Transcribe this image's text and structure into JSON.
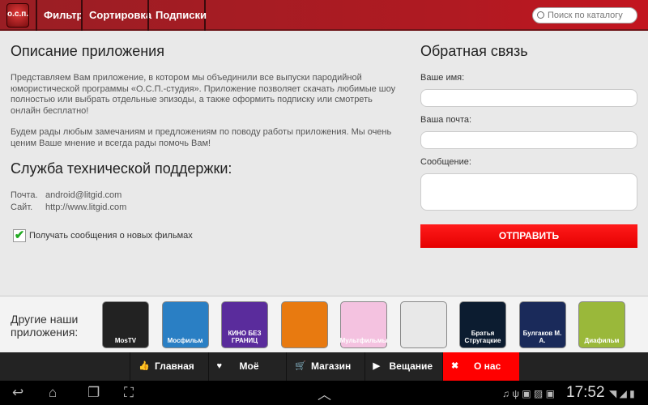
{
  "header": {
    "logo": "о.с.п.",
    "tabs": [
      "Фильтр",
      "Сортировка",
      "Подписки"
    ],
    "search_placeholder": "Поиск по каталогу"
  },
  "about": {
    "title": "Описание приложения",
    "p1": "Представляем Вам приложение, в котором мы объединили все выпуски пародийной юмористической программы «О.С.П.-студия». Приложение позволяет скачать любимые шоу полностью или выбрать отдельные эпизоды, а также оформить подписку или смотреть онлайн бесплатно!",
    "p2": "Будем рады любым замечаниям и предложениям по поводу работы приложения. Мы очень ценим Ваше мнение и всегда рады помочь Вам!"
  },
  "support": {
    "title": "Служба технической поддержки:",
    "mail_label": "Почта.",
    "mail": "android@litgid.com",
    "site_label": "Сайт.",
    "site": "http://www.litgid.com",
    "checkbox_label": "Получать сообщения о новых фильмах",
    "checkbox_checked": true
  },
  "feedback": {
    "title": "Обратная связь",
    "name_label": "Ваше имя:",
    "email_label": "Ваша почта:",
    "message_label": "Сообщение:",
    "name_value": "",
    "email_value": "",
    "message_value": "",
    "send": "ОТПРАВИТЬ"
  },
  "apps": {
    "label": "Другие наши приложения:",
    "items": [
      {
        "name": "MosTV",
        "color": "#222"
      },
      {
        "name": "Мосфильм",
        "color": "#2a7fc4"
      },
      {
        "name": "КИНО БЕЗ ГРАНИЦ",
        "color": "#5a2c9c"
      },
      {
        "name": "",
        "color": "#e87a10"
      },
      {
        "name": "Мультфильмы",
        "color": "#f4c2e0"
      },
      {
        "name": "",
        "color": "#e8e8e8"
      },
      {
        "name": "Братья Стругацкие",
        "color": "#0c1c30"
      },
      {
        "name": "Булгаков М. А.",
        "color": "#1a2a5a"
      },
      {
        "name": "Диафильм",
        "color": "#9ab83a"
      }
    ]
  },
  "nav": {
    "items": [
      {
        "icon": "👍",
        "label": "Главная"
      },
      {
        "icon": "♥",
        "label": "Моё"
      },
      {
        "icon": "🛒",
        "label": "Магазин"
      },
      {
        "icon": "▶",
        "label": "Вещание"
      },
      {
        "icon": "✖",
        "label": "О нас"
      }
    ],
    "active_color": "#ff0000"
  },
  "status": {
    "time": "17:52"
  }
}
